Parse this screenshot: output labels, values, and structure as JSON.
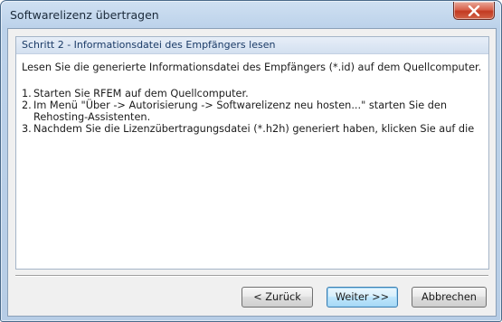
{
  "window": {
    "title": "Softwarelizenz übertragen"
  },
  "step": {
    "header": "Schritt 2 - Informationsdatei des Empfängers lesen",
    "intro": "Lesen Sie die generierte Informationsdatei des Empfängers (*.id) auf dem Quellcomputer.",
    "items": [
      {
        "num": "1.",
        "text": "Starten Sie RFEM auf dem Quellcomputer."
      },
      {
        "num": "2.",
        "text": "Im Menü \"Über -> Autorisierung -> Softwarelizenz neu hosten...\" starten Sie den Rehosting-Assistenten."
      },
      {
        "num": "3.",
        "text": "Nachdem Sie die Lizenzübertragungsdatei (*.h2h) generiert haben, klicken Sie auf die"
      }
    ]
  },
  "buttons": {
    "back": "< Zurück",
    "next": "Weiter >>",
    "cancel": "Abbrechen"
  },
  "icons": {
    "close": "close-icon"
  },
  "colors": {
    "close_button": "#c23a22",
    "header_text": "#1a3a66"
  }
}
